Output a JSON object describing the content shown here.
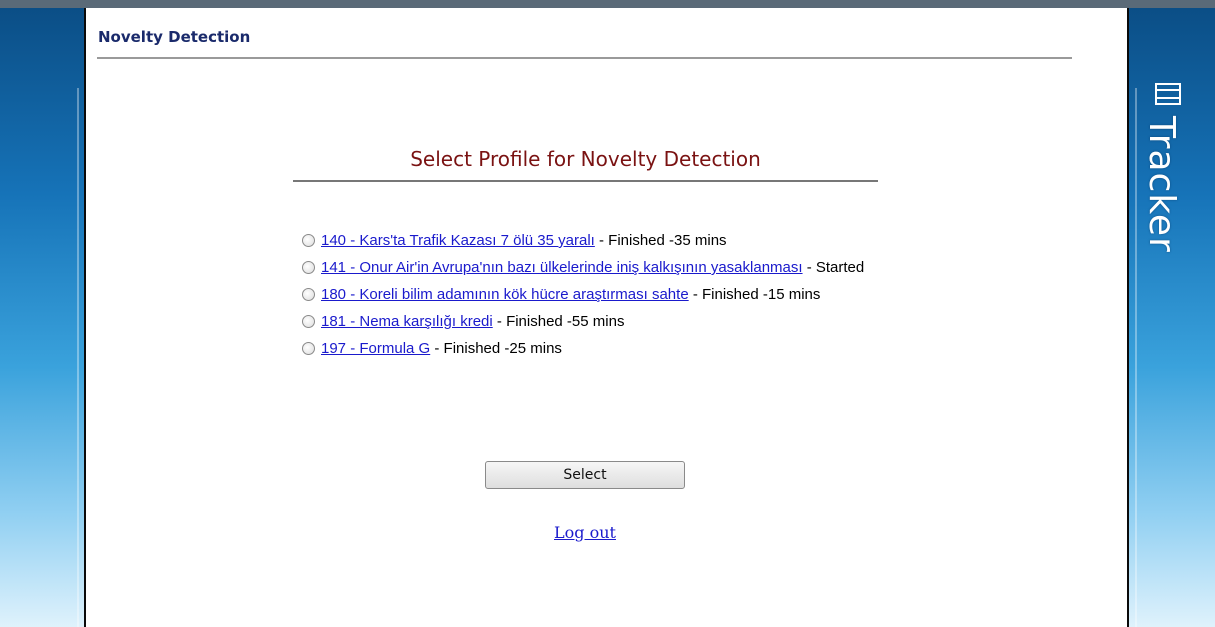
{
  "header": {
    "title": "Novelty Detection"
  },
  "brand": {
    "name": "Tracker",
    "icon": "e-logo-icon"
  },
  "main": {
    "title": "Select Profile for Novelty Detection",
    "profiles": [
      {
        "link": "140 - Kars'ta Trafik Kazası 7 ölü 35 yaralı",
        "status": " - Finished -35 mins"
      },
      {
        "link": "141 - Onur Air'in Avrupa'nın bazı ülkelerinde iniş kalkışının yasaklanması",
        "status": " - Started"
      },
      {
        "link": "180 - Koreli bilim adamının kök hücre araştırması sahte",
        "status": " - Finished -15 mins"
      },
      {
        "link": "181 - Nema karşılığı kredi",
        "status": " - Finished -55 mins"
      },
      {
        "link": "197 - Formula G",
        "status": " - Finished -25 mins"
      }
    ],
    "select_label": "Select",
    "logout_label": "Log out"
  },
  "colors": {
    "accent_blue": "#1673b8",
    "title_red": "#7a1212",
    "link_blue": "#1a1acc"
  }
}
